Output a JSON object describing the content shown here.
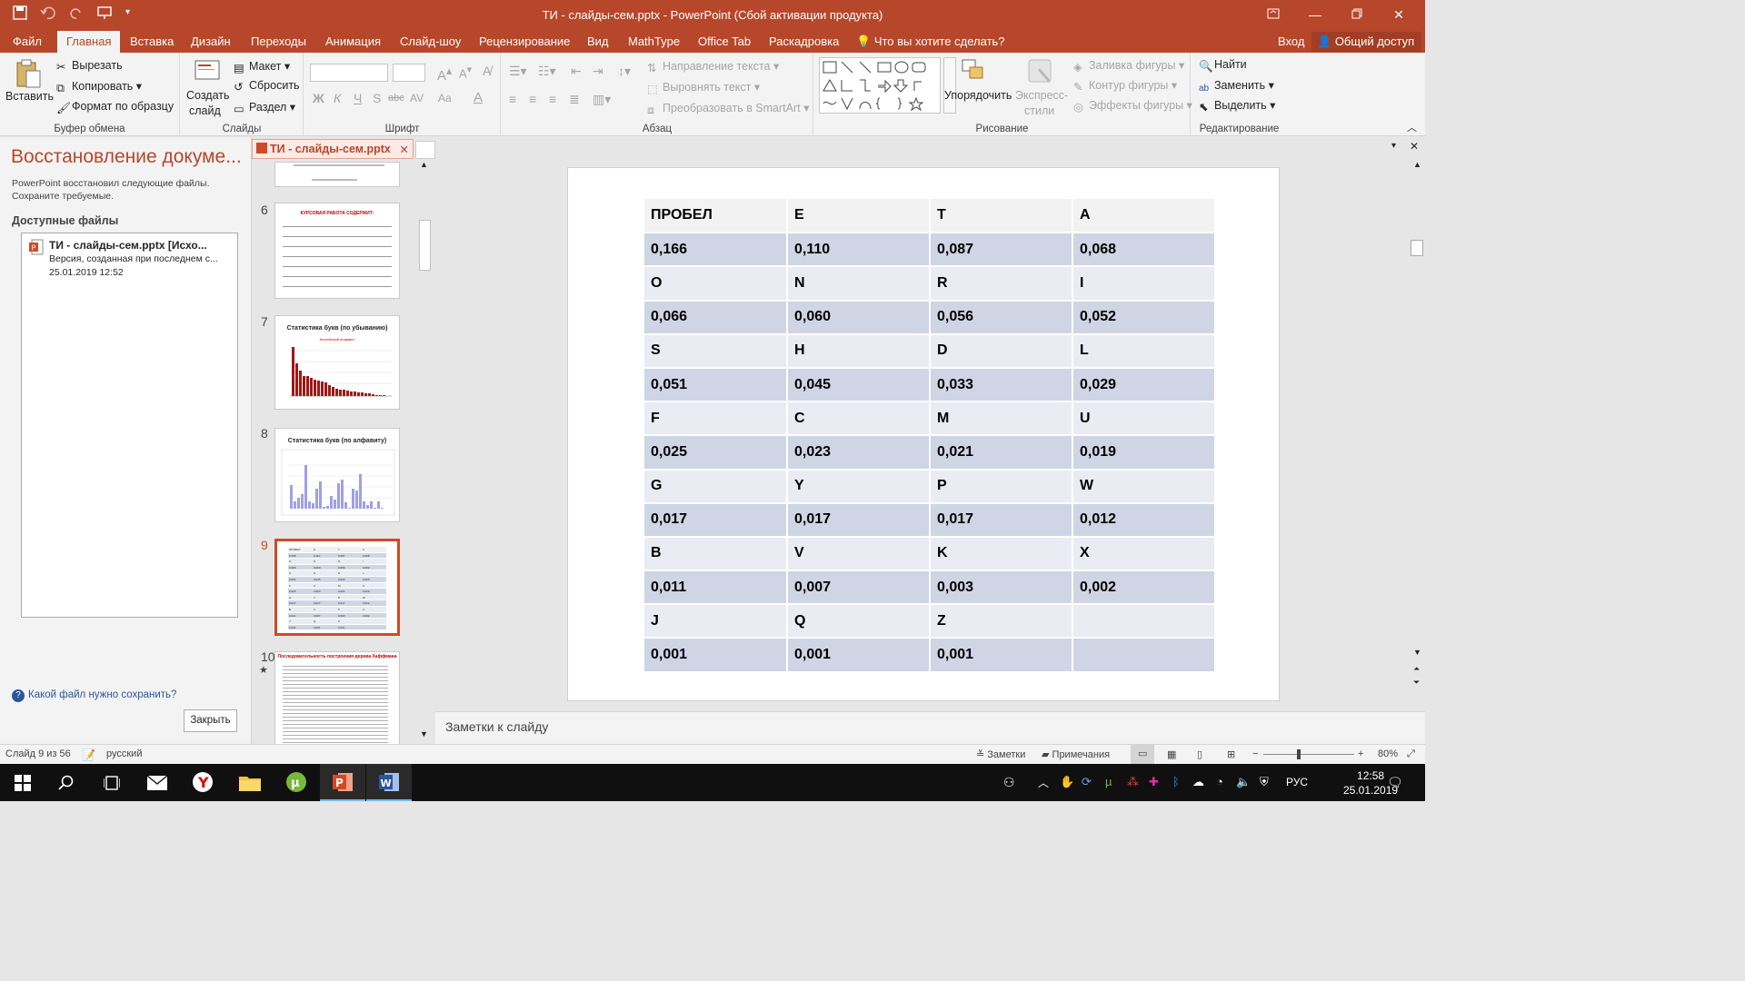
{
  "window": {
    "title": "ТИ - слайды-сем.pptx - PowerPoint (Сбой активации продукта)"
  },
  "tabs": {
    "file": "Файл",
    "home": "Главная",
    "insert": "Вставка",
    "design": "Дизайн",
    "transitions": "Переходы",
    "animation": "Анимация",
    "slideshow": "Слайд-шоу",
    "review": "Рецензирование",
    "view": "Вид",
    "mathtype": "MathType",
    "officetab": "Office Tab",
    "storyboard": "Раскадровка",
    "tellme": "Что вы хотите сделать?",
    "signin": "Вход",
    "share": "Общий доступ"
  },
  "ribbon": {
    "clipboard": {
      "paste": "Вставить",
      "cut": "Вырезать",
      "copy": "Копировать",
      "format_painter": "Формат по образцу",
      "label": "Буфер обмена"
    },
    "slides": {
      "new_slide": "Создать",
      "new_slide2": "слайд",
      "layout": "Макет",
      "reset": "Сбросить",
      "section": "Раздел",
      "label": "Слайды"
    },
    "font": {
      "label": "Шрифт",
      "bold": "Ж",
      "italic": "К",
      "underline": "Ч",
      "strike": "S",
      "abc": "abc",
      "spacing": "AV",
      "case": "Aa",
      "color": "A"
    },
    "paragraph": {
      "text_direction": "Направление текста",
      "align_text": "Выровнять текст",
      "smartart": "Преобразовать в SmartArt",
      "label": "Абзац"
    },
    "drawing": {
      "arrange": "Упорядочить",
      "quick_styles": "Экспресс-",
      "quick_styles2": "стили",
      "shape_fill": "Заливка фигуры",
      "shape_outline": "Контур фигуры",
      "shape_effects": "Эффекты фигуры",
      "label": "Рисование"
    },
    "editing": {
      "find": "Найти",
      "replace": "Заменить",
      "select": "Выделить",
      "label": "Редактирование"
    }
  },
  "recovery": {
    "title": "Восстановление докуме...",
    "desc": "PowerPoint восстановил следующие файлы. Сохраните требуемые.",
    "available_label": "Доступные файлы",
    "file_name": "ТИ - слайды-сем.pptx  [Исхо...",
    "file_sub": "Версия, созданная при последнем с...",
    "file_date": "25.01.2019 12:52",
    "help": "Какой файл нужно сохранить?",
    "close": "Закрыть"
  },
  "doc_tab": "ТИ - слайды-сем.pptx",
  "thumbnails": [
    {
      "num": "6",
      "title": "КУРСОВАЯ РАБОТА СОДЕРЖИТ:"
    },
    {
      "num": "7",
      "title": "Статистика букв (по убыванию)",
      "subtitle": "Английский алфавит"
    },
    {
      "num": "8",
      "title": "Статистика букв (по алфавиту)"
    },
    {
      "num": "9"
    },
    {
      "num": "10",
      "title": "Последовательность построения дерева Хаффмана"
    }
  ],
  "table": {
    "rows": [
      [
        "ПРОБЕЛ",
        "E",
        "T",
        "A"
      ],
      [
        "0,166",
        "0,110",
        "0,087",
        "0,068"
      ],
      [
        "O",
        "N",
        "R",
        "I"
      ],
      [
        "0,066",
        "0,060",
        "0,056",
        "0,052"
      ],
      [
        "S",
        "H",
        "D",
        "L"
      ],
      [
        "0,051",
        "0,045",
        "0,033",
        "0,029"
      ],
      [
        "F",
        "C",
        "M",
        "U"
      ],
      [
        "0,025",
        "0,023",
        "0,021",
        "0,019"
      ],
      [
        "G",
        "Y",
        "P",
        "W"
      ],
      [
        "0,017",
        "0,017",
        "0,017",
        "0,012"
      ],
      [
        "B",
        "V",
        "K",
        "X"
      ],
      [
        "0,011",
        "0,007",
        "0,003",
        "0,002"
      ],
      [
        "J",
        "Q",
        "Z",
        ""
      ],
      [
        "0,001",
        "0,001",
        "0,001",
        ""
      ]
    ]
  },
  "notes_placeholder": "Заметки к слайду",
  "status": {
    "slide": "Слайд 9 из 56",
    "lang": "русский",
    "notes": "Заметки",
    "comments": "Примечания",
    "zoom": "80%"
  },
  "taskbar": {
    "lang": "РУС",
    "time": "12:58",
    "date": "25.01.2019"
  },
  "colors": {
    "accent": "#b7472a",
    "table_odd": "#cfd5e4",
    "table_even": "#e9ecf3",
    "table_header": "#f2f2f2"
  }
}
